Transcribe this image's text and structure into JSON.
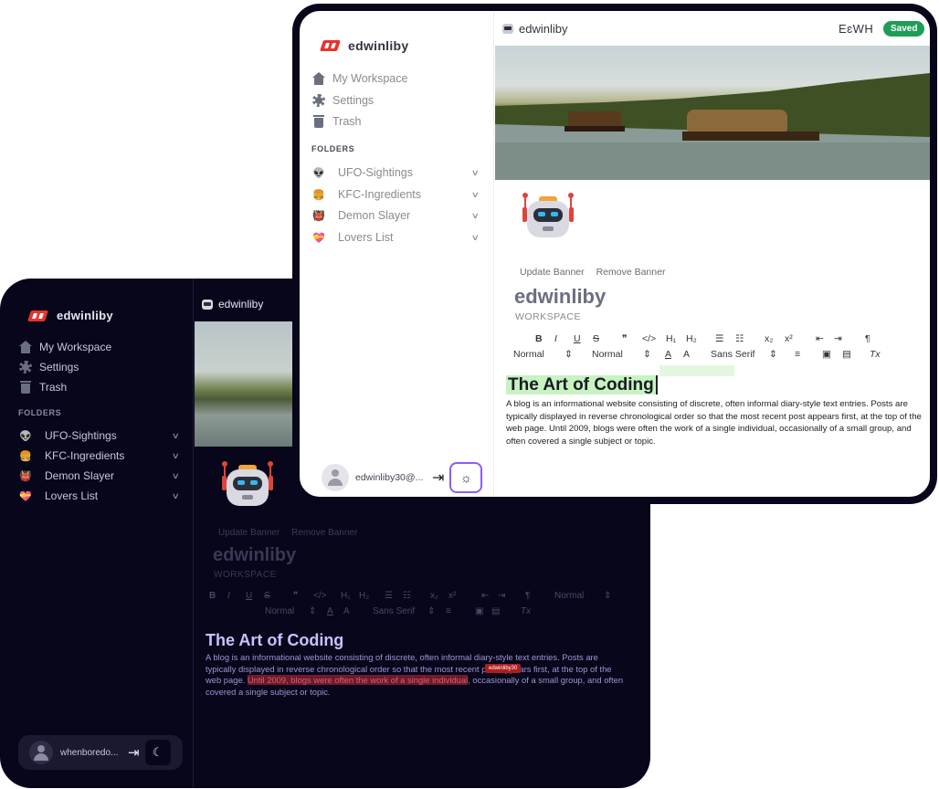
{
  "dark": {
    "app_name": "edwinliby",
    "nav": [
      {
        "label": "My Workspace"
      },
      {
        "label": "Settings"
      },
      {
        "label": "Trash"
      }
    ],
    "folders_title": "FOLDERS",
    "folders": [
      {
        "emoji": "👽",
        "label": "UFO-Sightings"
      },
      {
        "emoji": "🍔",
        "label": "KFC-Ingredients"
      },
      {
        "emoji": "👹",
        "label": "Demon Slayer"
      },
      {
        "emoji": "💝",
        "label": "Lovers List"
      }
    ],
    "user_name": "whenboredo...",
    "breadcrumb": "edwinliby",
    "update_banner": "Update Banner",
    "remove_banner": "Remove Banner",
    "workspace_title": "edwinliby",
    "workspace_sub": "WORKSPACE",
    "toolbar_row1": [
      "B",
      "I",
      "U",
      "S",
      "❞",
      "</>",
      "H₁",
      "H₂",
      "☰",
      "☷",
      "x₂",
      "x²",
      "⇤",
      "⇥",
      "¶",
      "Normal",
      "⇕"
    ],
    "toolbar_row2": [
      "Normal",
      "⇕",
      "A",
      "A",
      "Sans Serif",
      "⇕",
      "≡",
      "▣",
      "▤",
      "Tx"
    ],
    "post_title": "The Art of Coding",
    "post_body_pre": "A blog is an informational website consisting of discrete, often informal diary-style text entries. Posts are typically displayed in reverse chronological order so that the most recent ",
    "post_body_mid": "post appears first, at the top of the web page. ",
    "post_body_highlight": "Until 2009, blogs were often the work of a single individual",
    "post_body_post": ", occasionally of a small group, and often covered a single subject or topic.",
    "collab_tag": "edwinliby30"
  },
  "light": {
    "app_name": "edwinliby",
    "nav": [
      {
        "label": "My Workspace"
      },
      {
        "label": "Settings"
      },
      {
        "label": "Trash"
      }
    ],
    "folders_title": "FOLDERS",
    "folders": [
      {
        "emoji": "👽",
        "label": "UFO-Sightings"
      },
      {
        "emoji": "🍔",
        "label": "KFC-Ingredients"
      },
      {
        "emoji": "👹",
        "label": "Demon Slayer"
      },
      {
        "emoji": "💝",
        "label": "Lovers List"
      }
    ],
    "user_name": "edwinliby30@...",
    "breadcrumb": "edwinliby",
    "initials": "EɛWH",
    "saved": "Saved",
    "update_banner": "Update Banner",
    "remove_banner": "Remove Banner",
    "workspace_title": "edwinliby",
    "workspace_sub": "WORKSPACE",
    "toolbar_row1": [
      "B",
      "I",
      "U",
      "S",
      "❞",
      "</>",
      "H₁",
      "H₂",
      "☰",
      "☷",
      "x₂",
      "x²",
      "⇤",
      "⇥",
      "¶"
    ],
    "toolbar_row2": [
      "Normal",
      "⇕",
      "Normal",
      "⇕",
      "A",
      "A",
      "Sans Serif",
      "⇕",
      "≡",
      "▣",
      "▤",
      "Tx"
    ],
    "post_title": "The Art of Coding",
    "post_body": "A blog is an informational website consisting of discrete, often informal diary-style text entries. Posts are typically displayed in reverse chronological order so that the most recent post appears first, at the top of the web page. Until 2009, blogs were often the work of a single individual, occasionally of a small group, and often covered a single subject or topic."
  },
  "colors": {
    "accent_purple": "#8b5cf6",
    "saved_green": "#1f9d57",
    "dark_bg": "#07061a",
    "highlight_red": "#e25a6b",
    "selection_green": "#c7f2c2"
  }
}
